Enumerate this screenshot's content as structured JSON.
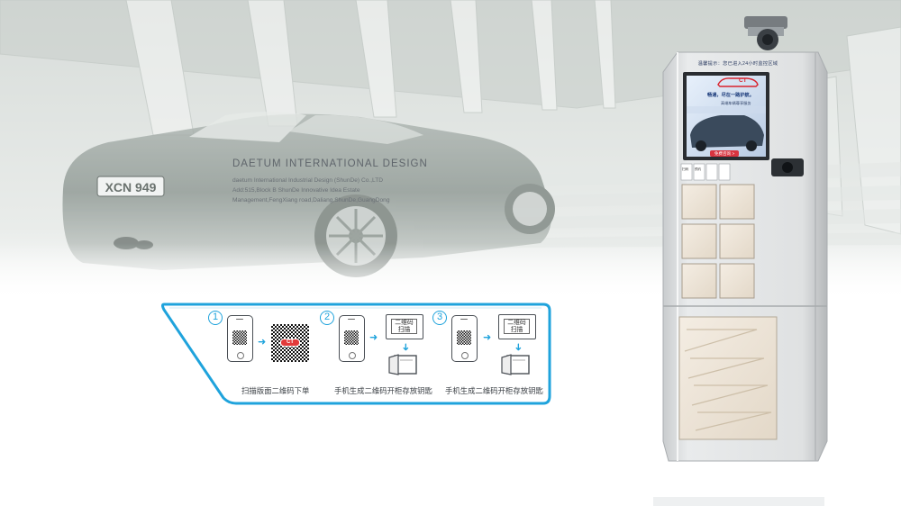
{
  "brand": {
    "title": "DAETUM INTERNATIONAL DESIGN",
    "lines": [
      "daetum International Industrial Design (ShunDe) Co.,LTD",
      "Add:515,Block B ShunDe Innovative Idea Estate",
      "Management,FengXiang road,Daliang,ShunDe,GuangDong"
    ]
  },
  "car": {
    "plate": "XCN 949"
  },
  "steps": [
    {
      "number": "1",
      "caption": "扫描版面二维码下单",
      "logo_text": "CT"
    },
    {
      "number": "2",
      "caption": "手机生成二维码开柜存放钥匙",
      "scan_label": "二维码\n扫描"
    },
    {
      "number": "3",
      "caption": "手机生成二维码开柜存放钥匙",
      "scan_label": "二维码\n扫描"
    }
  ],
  "kiosk": {
    "top_text": "温馨提示：您已进入24小时监控区域",
    "screen_logo": "CT",
    "screen_slogan": "畅通，尽在一路护航。",
    "screen_sub": "高端车辆尊享服务",
    "screen_button": "免费咨询 >",
    "side_labels": [
      "扫码",
      "预约"
    ]
  },
  "colors": {
    "accent": "#1fa3dc",
    "locker_door": "#ece2d4",
    "kiosk_body": "#d8dadc",
    "logo_red": "#e23b3b"
  }
}
